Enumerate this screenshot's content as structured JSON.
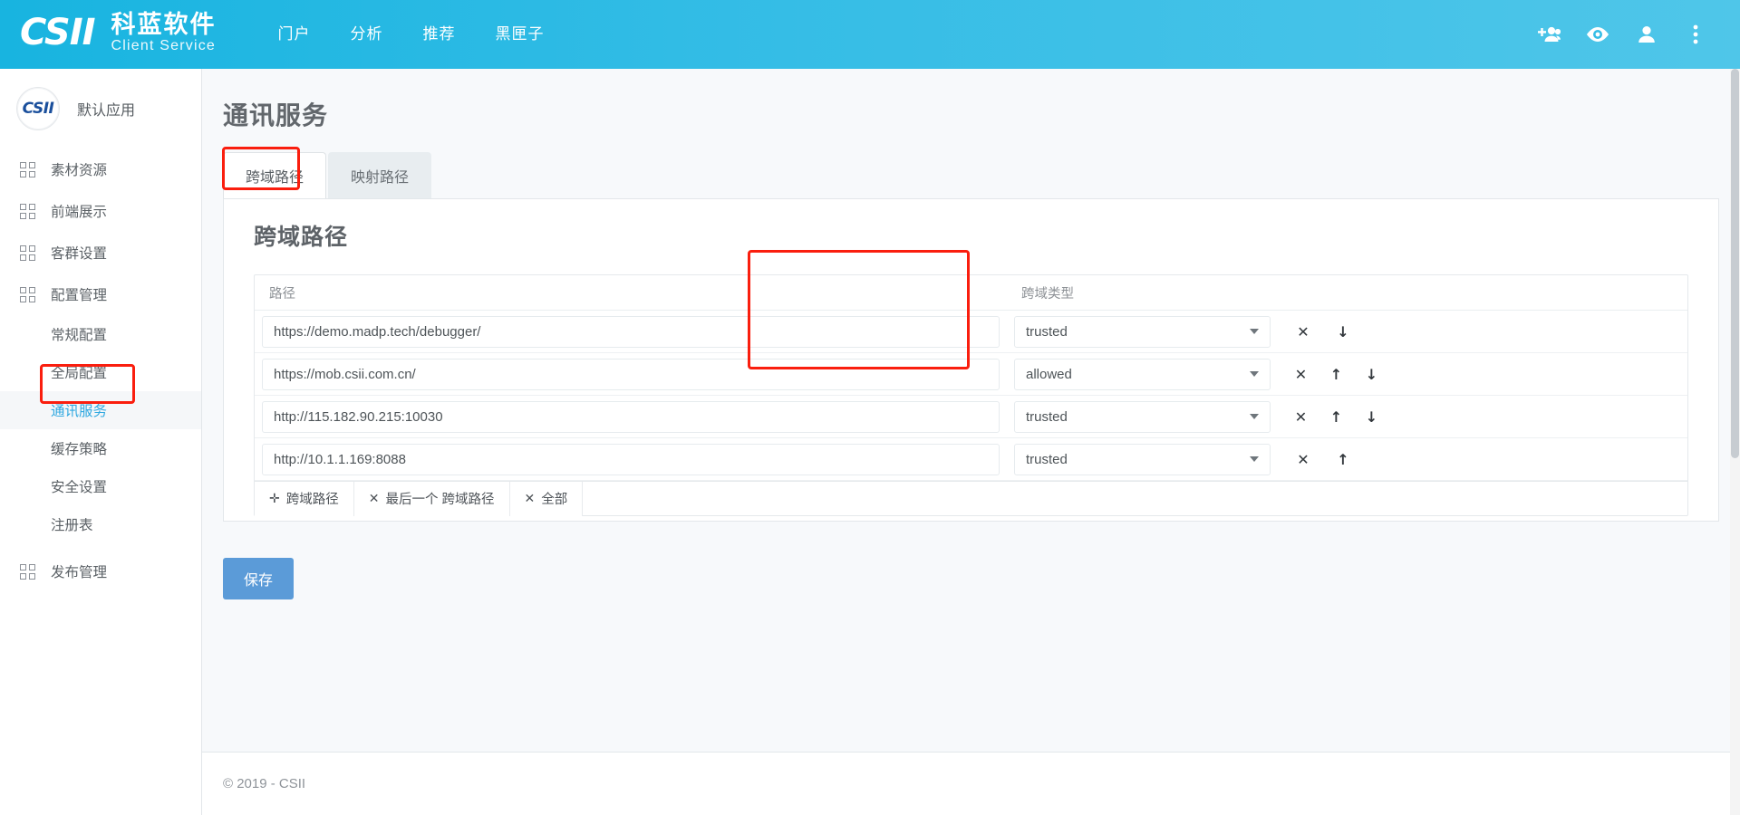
{
  "topbar": {
    "logo_text": "CSII",
    "brand_cn": "科蓝软件",
    "brand_en": "Client Service",
    "nav": [
      {
        "label": "门户"
      },
      {
        "label": "分析"
      },
      {
        "label": "推荐"
      },
      {
        "label": "黑匣子"
      }
    ],
    "icons": [
      {
        "name": "add-group-icon"
      },
      {
        "name": "eye-icon"
      },
      {
        "name": "person-icon"
      },
      {
        "name": "more-vertical-icon"
      }
    ]
  },
  "sidebar": {
    "app_logo_text": "CSII",
    "app_name": "默认应用",
    "items": [
      {
        "label": "素材资源",
        "type": "group"
      },
      {
        "label": "前端展示",
        "type": "group"
      },
      {
        "label": "客群设置",
        "type": "group"
      },
      {
        "label": "配置管理",
        "type": "group"
      }
    ],
    "subitems": [
      {
        "label": "常规配置",
        "active": false
      },
      {
        "label": "全局配置",
        "active": false
      },
      {
        "label": "通讯服务",
        "active": true
      },
      {
        "label": "缓存策略",
        "active": false
      },
      {
        "label": "安全设置",
        "active": false
      },
      {
        "label": "注册表",
        "active": false
      }
    ],
    "items_bottom": [
      {
        "label": "发布管理",
        "type": "group"
      }
    ]
  },
  "main": {
    "page_title": "通讯服务",
    "tabs": [
      {
        "label": "跨域路径",
        "active": true
      },
      {
        "label": "映射路径",
        "active": false
      }
    ],
    "panel_title": "跨域路径",
    "table": {
      "headers": {
        "path": "路径",
        "type": "跨域类型",
        "actions": ""
      },
      "rows": [
        {
          "path": "https://demo.madp.tech/debugger/",
          "type": "trusted",
          "buttons": [
            "✕",
            "↓"
          ]
        },
        {
          "path": "https://mob.csii.com.cn/",
          "type": "allowed",
          "buttons": [
            "✕",
            "↑",
            "↓"
          ]
        },
        {
          "path": "http://115.182.90.215:10030",
          "type": "trusted",
          "buttons": [
            "✕",
            "↑",
            "↓"
          ]
        },
        {
          "path": "http://10.1.1.169:8088",
          "type": "trusted",
          "buttons": [
            "✕",
            "↑"
          ]
        }
      ],
      "type_options": [
        "trusted",
        "allowed"
      ],
      "toolbar": [
        {
          "glyph": "✛",
          "label": "跨域路径"
        },
        {
          "glyph": "✕",
          "label": "最后一个 跨域路径"
        },
        {
          "glyph": "✕",
          "label": "全部"
        }
      ]
    },
    "save_label": "保存",
    "footer": "© 2019 - CSII"
  },
  "colors": {
    "brand_blue": "#35bde6",
    "accent_link": "#2fa8e0",
    "save_button": "#5b9bd8",
    "highlight_red": "#fa1e0e"
  }
}
